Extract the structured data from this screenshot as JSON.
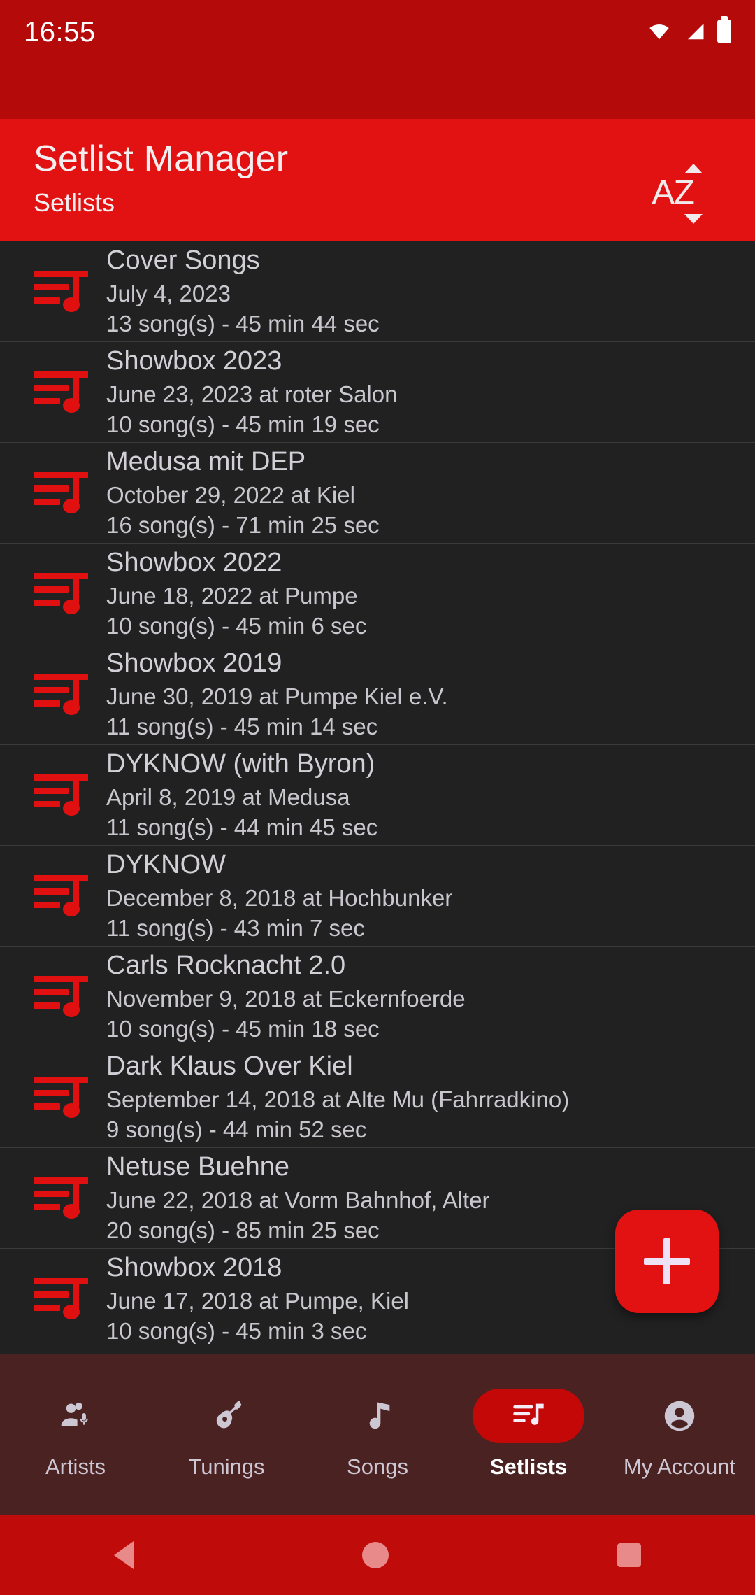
{
  "status_bar": {
    "time": "16:55",
    "icons": [
      "wifi-icon",
      "signal-icon",
      "battery-icon"
    ]
  },
  "app_bar": {
    "title": "Setlist Manager",
    "subtitle": "Setlists",
    "sort_button": {
      "label": "AZ",
      "icon": "sort-az-icon"
    }
  },
  "setlists": [
    {
      "name": "Cover Songs",
      "date": "July 4, 2023",
      "meta": "13 song(s) - 45 min 44 sec"
    },
    {
      "name": "Showbox 2023",
      "date": "June 23, 2023 at roter Salon",
      "meta": "10 song(s) - 45 min 19 sec"
    },
    {
      "name": "Medusa mit DEP",
      "date": "October 29, 2022 at Kiel",
      "meta": "16 song(s) - 71 min 25 sec"
    },
    {
      "name": "Showbox 2022",
      "date": "June 18, 2022 at Pumpe",
      "meta": "10 song(s) - 45 min 6 sec"
    },
    {
      "name": "Showbox 2019",
      "date": "June 30, 2019 at Pumpe Kiel e.V.",
      "meta": "11 song(s) - 45 min 14 sec"
    },
    {
      "name": "DYKNOW (with Byron)",
      "date": "April 8, 2019 at Medusa",
      "meta": "11 song(s) - 44 min 45 sec"
    },
    {
      "name": "DYKNOW",
      "date": "December 8, 2018 at Hochbunker",
      "meta": "11 song(s) - 43 min 7 sec"
    },
    {
      "name": "Carls Rocknacht 2.0",
      "date": "November 9, 2018 at Eckernfoerde",
      "meta": "10 song(s) - 45 min 18 sec"
    },
    {
      "name": "Dark Klaus Over Kiel",
      "date": "September 14, 2018 at Alte Mu (Fahrradkino)",
      "meta": "9 song(s) - 44 min 52 sec"
    },
    {
      "name": "Netuse Buehne",
      "date": "June 22, 2018 at Vorm Bahnhof, Alter",
      "meta": "20 song(s) - 85 min 25 sec"
    },
    {
      "name": "Showbox 2018",
      "date": "June 17, 2018 at Pumpe, Kiel",
      "meta": "10 song(s) - 45 min 3 sec"
    }
  ],
  "fab": {
    "icon": "plus-icon",
    "label": "Add setlist"
  },
  "bottom_nav": {
    "items": [
      {
        "label": "Artists",
        "icon": "artists-mic-icon",
        "active": false
      },
      {
        "label": "Tunings",
        "icon": "guitar-icon",
        "active": false
      },
      {
        "label": "Songs",
        "icon": "music-note-icon",
        "active": false
      },
      {
        "label": "Setlists",
        "icon": "playlist-icon",
        "active": true
      },
      {
        "label": "My Account",
        "icon": "account-icon",
        "active": false
      }
    ]
  },
  "system_nav": {
    "back": "back-triangle-icon",
    "home": "home-circle-icon",
    "recents": "recents-square-icon"
  },
  "colors": {
    "status_bar": "#b40a0a",
    "app_bar": "#e21212",
    "accent": "#e01010",
    "list_bg": "#212121",
    "bottom_nav_bg": "#4b2222",
    "active_pill": "#c40808",
    "system_nav": "#c00b0b"
  }
}
